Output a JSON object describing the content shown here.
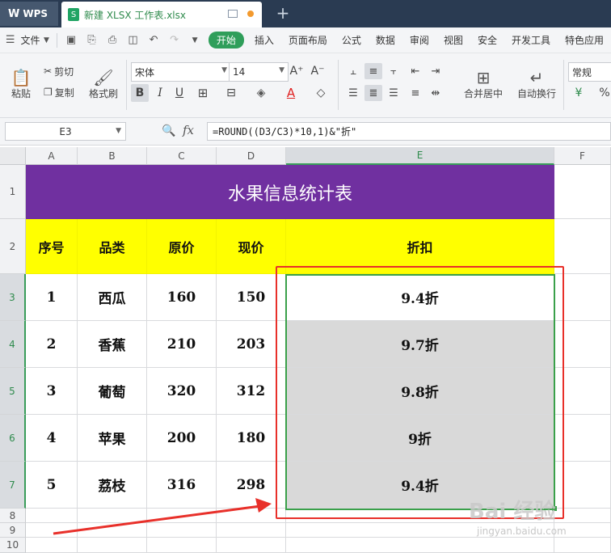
{
  "tabs": {
    "app": "WPS",
    "file": "新建 XLSX 工作表.xlsx",
    "new_tab": "+"
  },
  "menu": {
    "file": "文件",
    "items": [
      "开始",
      "插入",
      "页面布局",
      "公式",
      "数据",
      "审阅",
      "视图",
      "安全",
      "开发工具",
      "特色应用"
    ]
  },
  "toolbar": {
    "paste": "粘贴",
    "cut": "剪切",
    "copy": "复制",
    "format_painter": "格式刷",
    "font_name": "宋体",
    "font_size": "14",
    "merge_center": "合并居中",
    "wrap_text": "自动换行",
    "number_format": "常规"
  },
  "formula_bar": {
    "cell_ref": "E3",
    "fx": "fx",
    "formula": "=ROUND((D3/C3)*10,1)&\"折\""
  },
  "columns": [
    "A",
    "B",
    "C",
    "D",
    "E",
    "F"
  ],
  "rows": [
    "1",
    "2",
    "3",
    "4",
    "5",
    "6",
    "7",
    "8",
    "9",
    "10"
  ],
  "sheet": {
    "title": "水果信息统计表",
    "headers": [
      "序号",
      "品类",
      "原价",
      "现价",
      "折扣"
    ],
    "data": [
      [
        "1",
        "西瓜",
        "160",
        "150",
        "9.4折"
      ],
      [
        "2",
        "香蕉",
        "210",
        "203",
        "9.7折"
      ],
      [
        "3",
        "葡萄",
        "320",
        "312",
        "9.8折"
      ],
      [
        "4",
        "苹果",
        "200",
        "180",
        "9折"
      ],
      [
        "5",
        "荔枝",
        "316",
        "298",
        "9.4折"
      ]
    ]
  },
  "watermark": {
    "main": "Bai 经验",
    "sub": "jingyan.baidu.com"
  },
  "colors": {
    "title_bg": "#7030a0",
    "header_bg": "#ffff00",
    "selection": "#3aa04a",
    "annotation": "#e8302a",
    "active_menu": "#2f9e5a"
  }
}
